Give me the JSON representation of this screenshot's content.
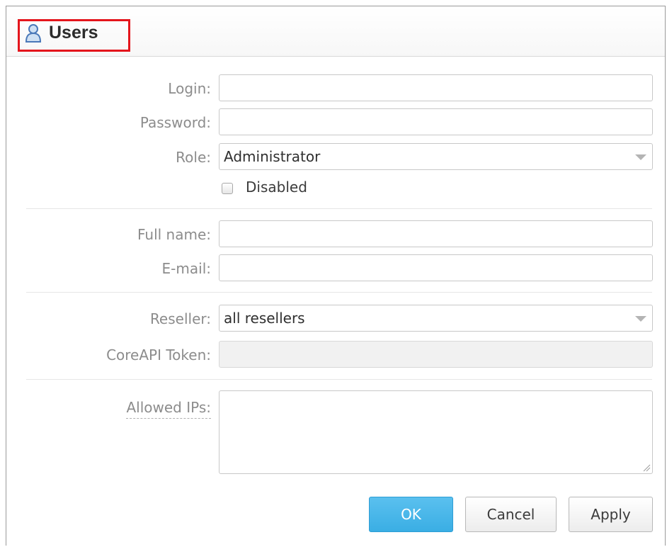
{
  "window": {
    "title": "Users",
    "icon": "user-icon"
  },
  "form": {
    "login": {
      "label": "Login:",
      "value": ""
    },
    "password": {
      "label": "Password:",
      "value": ""
    },
    "role": {
      "label": "Role:",
      "value": "Administrator"
    },
    "disabled": {
      "label": "Disabled",
      "checked": false
    },
    "full_name": {
      "label": "Full name:",
      "value": ""
    },
    "email": {
      "label": "E-mail:",
      "value": ""
    },
    "reseller": {
      "label": "Reseller:",
      "value": "all resellers"
    },
    "coreapi_token": {
      "label": "CoreAPI Token:",
      "value": ""
    },
    "allowed_ips": {
      "label": "Allowed IPs:",
      "value": ""
    }
  },
  "buttons": {
    "ok": "OK",
    "cancel": "Cancel",
    "apply": "Apply"
  },
  "colors": {
    "highlight_border": "#e4151c",
    "primary_button": "#3aaee4",
    "label_text": "#8c8c8c"
  }
}
